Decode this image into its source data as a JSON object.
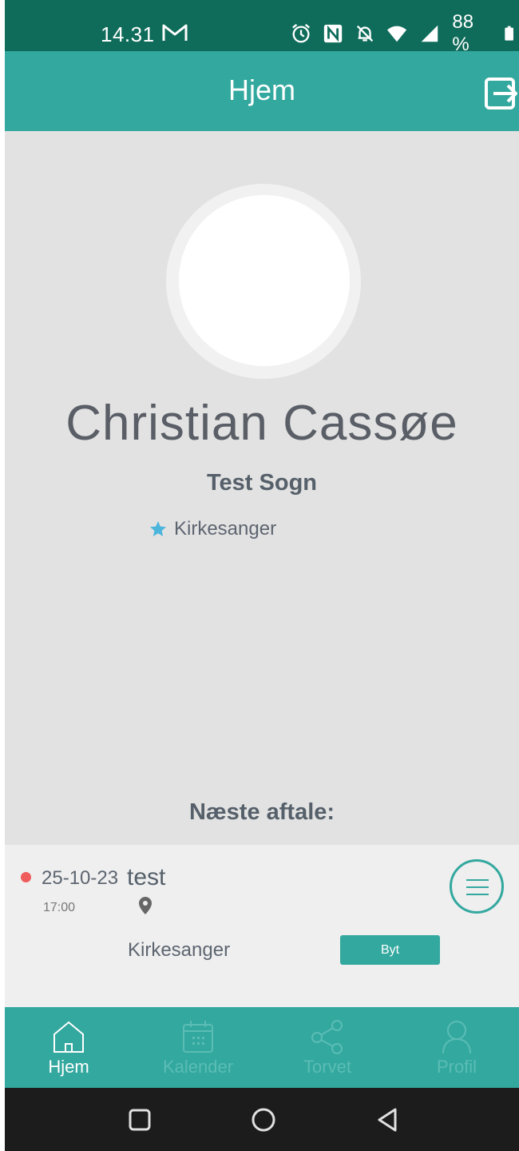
{
  "status_bar": {
    "time": "14.31",
    "battery": "88 %",
    "icons": [
      "gmail-icon",
      "alarm-icon",
      "nfc-icon",
      "bell-off-icon",
      "wifi-icon",
      "signal-icon",
      "battery-icon"
    ]
  },
  "app_bar": {
    "title": "Hjem"
  },
  "profile": {
    "name": "Christian Cassøe",
    "parish": "Test Sogn",
    "role": "Kirkesanger"
  },
  "next_appointment": {
    "heading": "Næste aftale:",
    "date": "25-10-23",
    "title": "test",
    "time": "17:00",
    "role": "Kirkesanger",
    "swap_label": "Byt"
  },
  "bottom_nav": {
    "items": [
      {
        "label": "Hjem",
        "active": true
      },
      {
        "label": "Kalender",
        "active": false
      },
      {
        "label": "Torvet",
        "active": false
      },
      {
        "label": "Profil",
        "active": false
      }
    ]
  },
  "colors": {
    "primary": "#33a89f",
    "status_bar": "#0f6c5a",
    "background": "#e2e2e2",
    "indicator": "#f05b5b",
    "star": "#4bb5dc"
  }
}
